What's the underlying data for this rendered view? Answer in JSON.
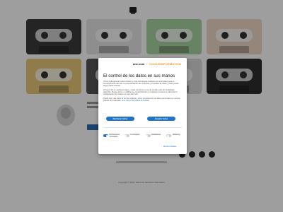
{
  "dialog": {
    "brand": {
      "logo_text": "one.com",
      "separator": "+",
      "partner_text": "COOKIEINFORMATION"
    },
    "title": "El control de los datos en sus manos",
    "paragraphs": [
      "Como regla general, estos cookies y otras tecnologías similares son esenciales para el funcionamiento del sitio, la personalización de contenido y el análisis de tráfico. Usted puede elegir cuáles aceptar.",
      "Al hacer clic en «Aceptar todas», usted consiente el uso de cookies para las finalidades descritas. Puede retirar o modificar su consentimiento en cualquier momento a través de la configuración de cookies en este sitio web.",
      "Puede leer más sobre el uso de cookies y cómo procesamos sus datos personales en nuestra política de privacidad."
    ],
    "policy_link": "Leer más en la política de cookies",
    "reject_label": "Rechazar todas",
    "accept_label": "Aceptar todas",
    "toggles": [
      {
        "label": "Estrictamente necesarias",
        "on": true
      },
      {
        "label": "Funcionales",
        "on": false
      },
      {
        "label": "Estadísticas",
        "on": false
      },
      {
        "label": "Marketing",
        "on": false
      }
    ],
    "details_link": "Mostrar detalles"
  },
  "background": {
    "cassette_colors": [
      "#3b3b3b",
      "#e6e6e6",
      "#a9d3a0",
      "#f0d8c8",
      "#e8c87a",
      "#555555",
      "#d9d9d9",
      "#2e2e2e"
    ],
    "footer_copyright": "Copyright © 2021 Todos los derechos reservados"
  },
  "colors": {
    "accent": "#1f74c9",
    "partner": "#f29b1d",
    "overlay": "rgba(0,0,0,0.38)"
  }
}
